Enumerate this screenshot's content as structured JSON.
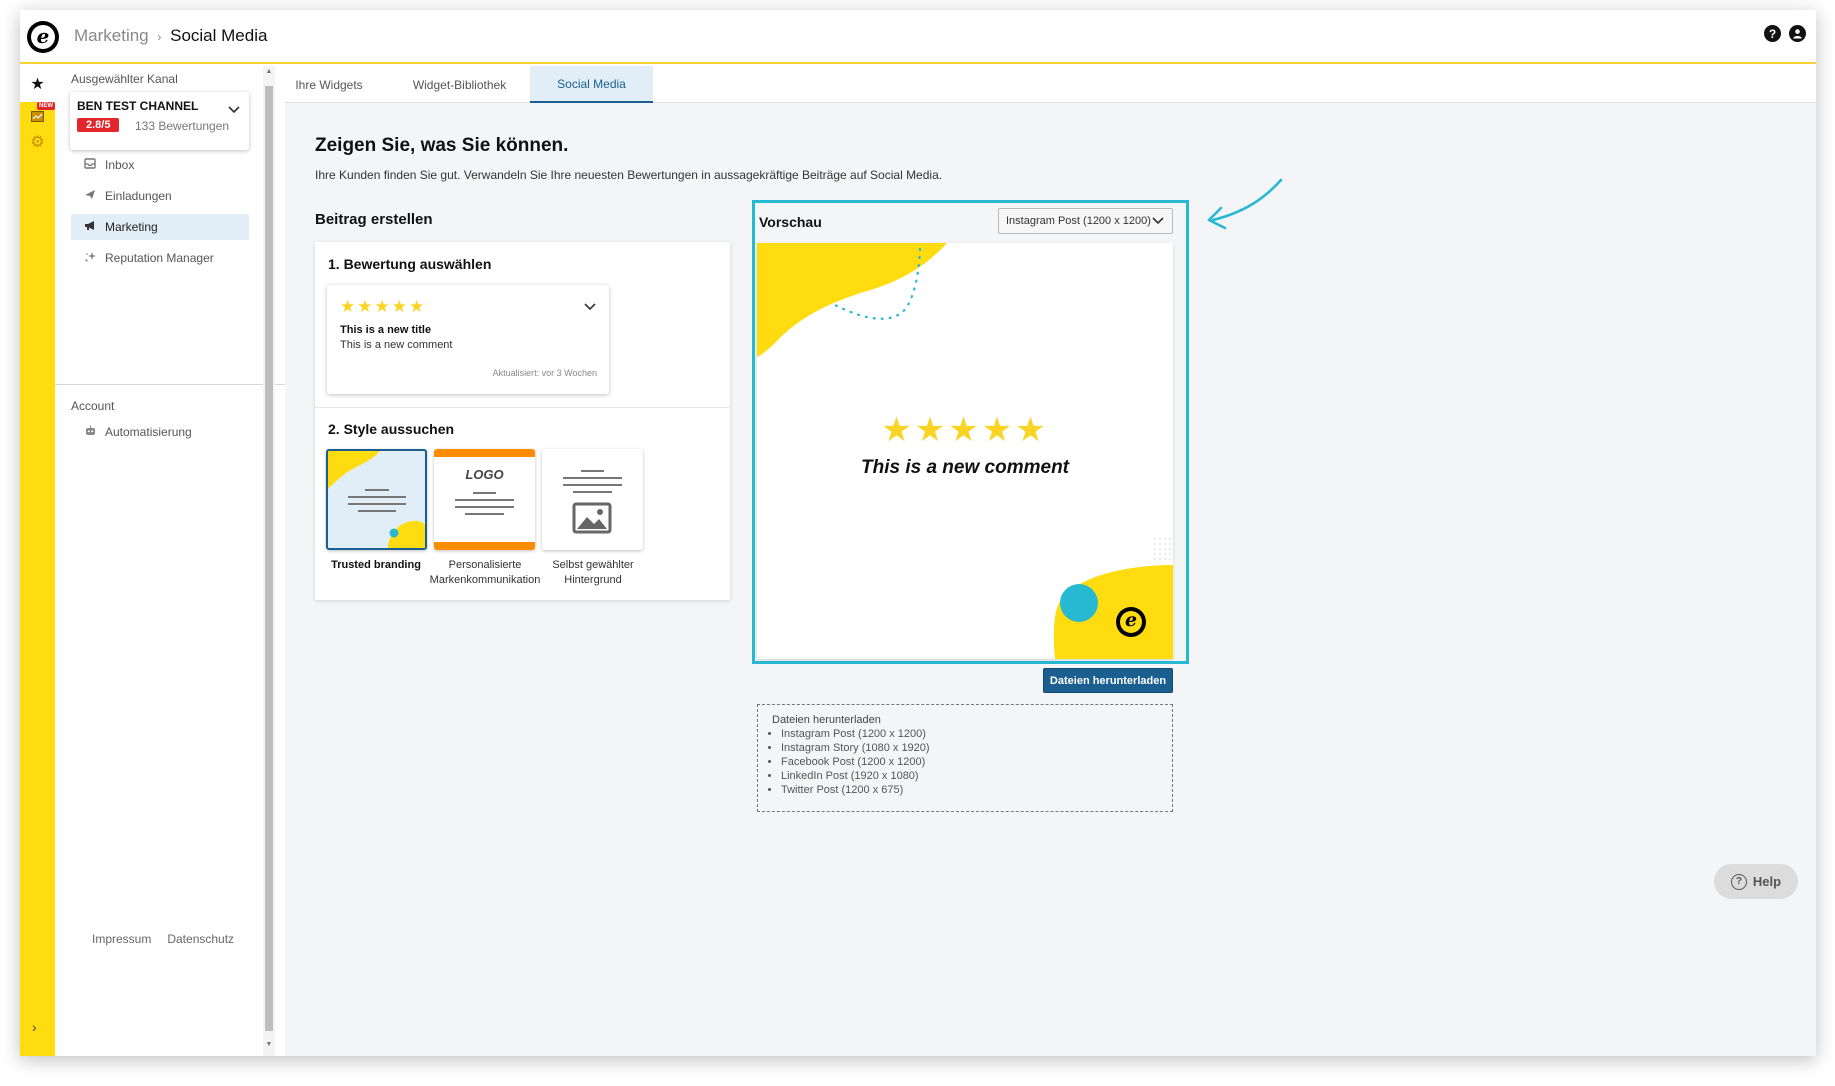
{
  "header": {
    "breadcrumb_parent": "Marketing",
    "breadcrumb_separator": "›",
    "breadcrumb_current": "Social Media",
    "logo_letter": "e",
    "help_icon": "?",
    "account_icon": "user-icon"
  },
  "rail": {
    "star_icon": "★",
    "new_badge": "NEW",
    "gear_icon": "⚙",
    "expand_icon": "›"
  },
  "sidebar": {
    "channel_label": "Ausgewählter Kanal",
    "channel_name": "BEN TEST CHANNEL",
    "channel_rating": "2.8/5",
    "channel_reviews": "133 Bewertungen",
    "nav": [
      {
        "label": "Inbox",
        "icon": "inbox-icon"
      },
      {
        "label": "Einladungen",
        "icon": "send-icon"
      },
      {
        "label": "Marketing",
        "icon": "megaphone-icon"
      },
      {
        "label": "Reputation Manager",
        "icon": "sparkle-icon"
      }
    ],
    "account_label": "Account",
    "account_nav": [
      {
        "label": "Automatisierung",
        "icon": "robot-icon"
      }
    ],
    "footer": {
      "impressum": "Impressum",
      "datenschutz": "Datenschutz"
    }
  },
  "tabs": [
    {
      "label": "Ihre Widgets"
    },
    {
      "label": "Widget-Bibliothek"
    },
    {
      "label": "Social Media",
      "active": true
    }
  ],
  "main": {
    "heading": "Zeigen Sie, was Sie können.",
    "intro": "Ihre Kunden finden Sie gut. Verwandeln Sie Ihre neuesten Bewertungen in aussagekräftige Beiträge auf Social Media.",
    "create_heading": "Beitrag erstellen",
    "step1": "1. Bewertung auswählen",
    "review": {
      "stars": "★★★★★",
      "title": "This is a new title",
      "comment": "This is a new comment",
      "updated": "Aktualisiert: vor 3 Wochen"
    },
    "step2": "2. Style aussuchen",
    "styles": [
      {
        "label": "Trusted branding",
        "selected": true
      },
      {
        "label": "Personalisierte Markenkommunikation",
        "logo_text": "LOGO"
      },
      {
        "label": "Selbst gewählter Hintergrund"
      }
    ]
  },
  "preview": {
    "title": "Vorschau",
    "format_selected": "Instagram Post (1200 x 1200)",
    "stars": "★★★★★",
    "comment": "This is a new comment",
    "logo_letter": "e"
  },
  "download": {
    "button": "Dateien herunterladen",
    "box_title": "Dateien herunterladen",
    "files": [
      "Instagram Post (1200 x 1200)",
      "Instagram Story (1080 x 1920)",
      "Facebook Post (1200 x 1200)",
      "LinkedIn Post (1920 x 1080)",
      "Twitter Post (1200 x 675)"
    ]
  },
  "help": {
    "label": "Help",
    "icon": "?"
  },
  "colors": {
    "accent_yellow": "#ffdc0f",
    "brand_blue": "#1a5f8f",
    "highlight_cyan": "#27b9d2",
    "rating_red": "#e3262c"
  }
}
